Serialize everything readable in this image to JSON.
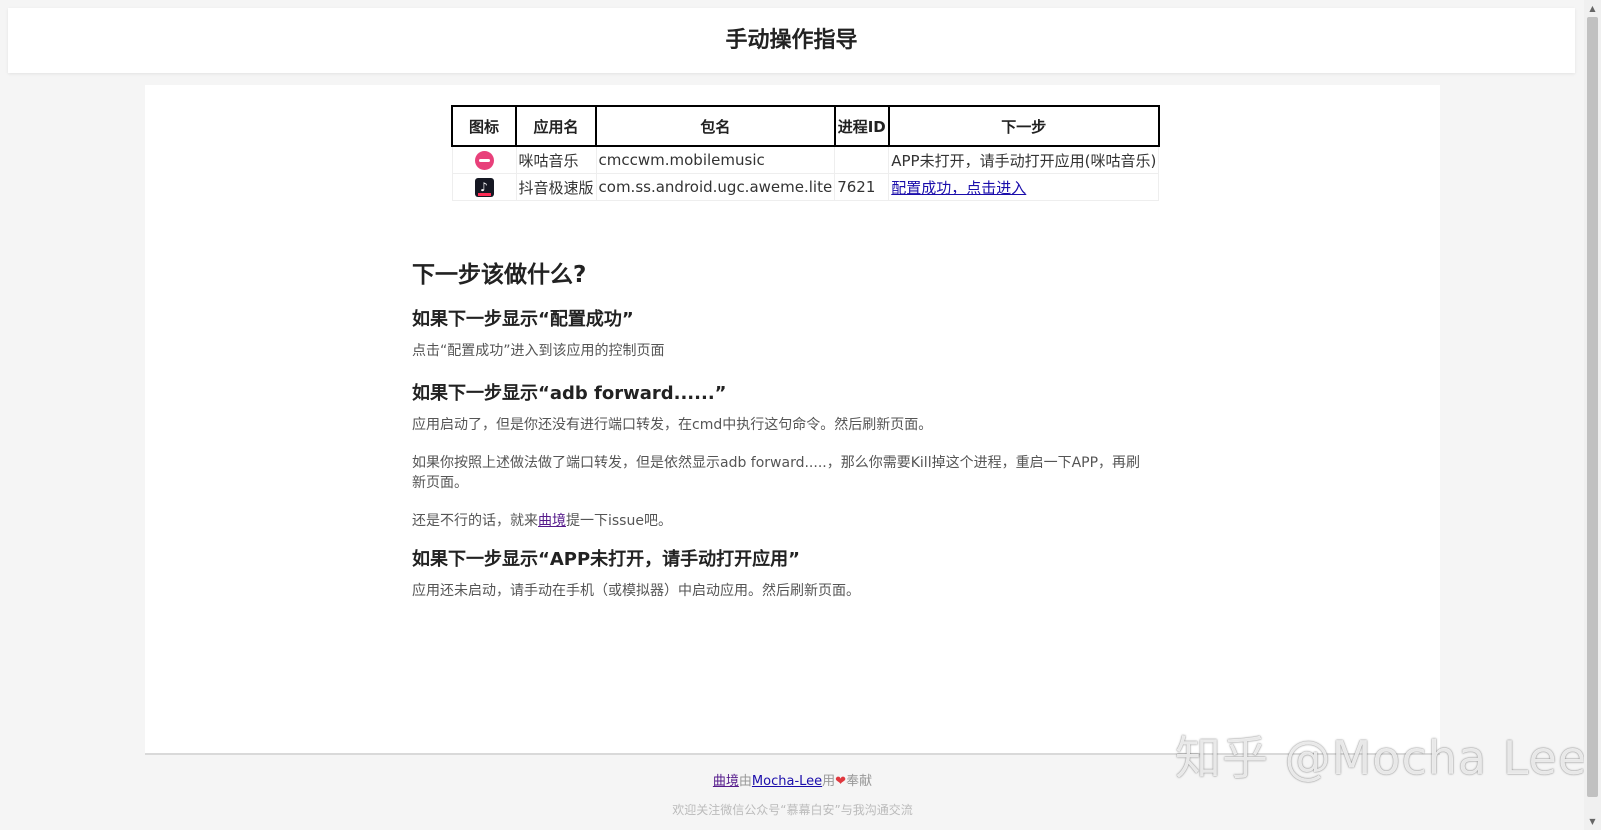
{
  "header": {
    "title": "手动操作指导"
  },
  "table": {
    "headers": {
      "icon": "图标",
      "name": "应用名",
      "package": "包名",
      "pid": "进程ID",
      "next": "下一步"
    },
    "rows": [
      {
        "icon": "migu-music-icon",
        "name": "咪咕音乐",
        "package": "cmccwm.mobilemusic",
        "pid": "",
        "next": "APP未打开，请手动打开应用(咪咕音乐)",
        "next_is_link": false
      },
      {
        "icon": "douyin-lite-icon",
        "name": "抖音极速版",
        "package": "com.ss.android.ugc.aweme.lite",
        "pid": "7621",
        "next": "配置成功，点击进入",
        "next_is_link": true
      }
    ]
  },
  "guide": {
    "title": "下一步该做什么?",
    "sections": [
      {
        "heading": "如果下一步显示“配置成功”",
        "p1": "点击“配置成功”进入到该应用的控制页面"
      },
      {
        "heading": "如果下一步显示“adb forward......”",
        "p1": "应用启动了，但是你还没有进行端口转发，在cmd中执行这句命令。然后刷新页面。",
        "p2": "如果你按照上述做法做了端口转发，但是依然显示adb forward.....，那么你需要Kill掉这个进程，重启一下APP，再刷新页面。",
        "p3_before": "还是不行的话，就来",
        "p3_link": "曲境",
        "p3_after": "提一下issue吧。"
      },
      {
        "heading": "如果下一步显示“APP未打开，请手动打开应用”",
        "p1": "应用还未启动，请手动在手机（或模拟器）中启动应用。然后刷新页面。"
      }
    ]
  },
  "footer": {
    "project_link": "曲境",
    "by": "由",
    "author_link": "Mocha-Lee",
    "with": "用",
    "heart_icon": "heart-icon",
    "contributed": "奉献",
    "line2": "欢迎关注微信公众号“慕幕白安”与我沟通交流"
  },
  "watermark": "知乎 @Mocha Lee",
  "colors": {
    "link": "#1a0dab",
    "visited_link": "#551a8b",
    "heart": "#e0383e",
    "page_bg": "#f5f5f5"
  }
}
